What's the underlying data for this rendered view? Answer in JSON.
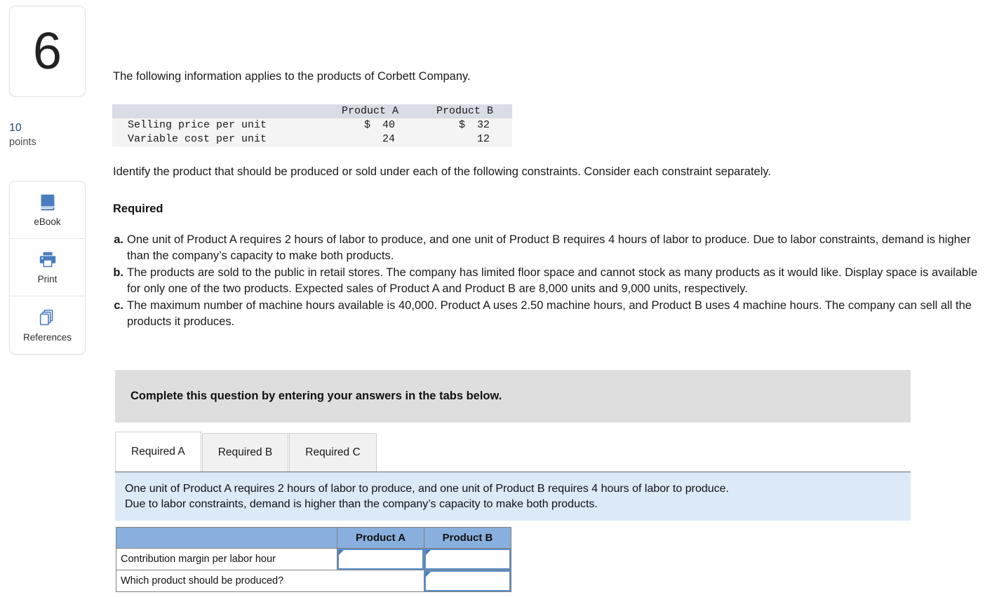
{
  "sidebar": {
    "question_number": "6",
    "points_value": "10",
    "points_label": "points",
    "tools": [
      {
        "name": "ebook",
        "label": "eBook",
        "icon": "book-icon"
      },
      {
        "name": "print",
        "label": "Print",
        "icon": "printer-icon"
      },
      {
        "name": "references",
        "label": "References",
        "icon": "copy-pages-icon"
      }
    ]
  },
  "main": {
    "intro": "The following information applies to the products of Corbett Company.",
    "identify": "Identify the product that should be produced or sold under each of the following constraints. Consider each constraint separately.",
    "required_heading": "Required",
    "requirements": [
      {
        "bullet": "a.",
        "text": "One unit of Product A requires 2 hours of labor to produce, and one unit of Product B requires 4 hours of labor to produce. Due to labor constraints, demand is higher than the company’s capacity to make both products."
      },
      {
        "bullet": "b.",
        "text": "The products are sold to the public in retail stores. The company has limited floor space and cannot stock as many products as it would like. Display space is available for only one of the two products. Expected sales of Product A and Product B are 8,000 units and 9,000 units, respectively."
      },
      {
        "bullet": "c.",
        "text": "The maximum number of machine hours available is 40,000. Product A uses 2.50 machine hours, and Product B uses 4 machine hours. The company can sell all the products it produces."
      }
    ],
    "banner_text": "Complete this question by entering your answers in the tabs below.",
    "tabs": [
      {
        "label": "Required A",
        "active": true
      },
      {
        "label": "Required B",
        "active": false
      },
      {
        "label": "Required C",
        "active": false
      }
    ],
    "instruction_box": {
      "line1": "One unit of Product A requires 2 hours of labor to produce, and one unit of Product B requires 4 hours of labor to produce.",
      "line2": "Due to labor constraints, demand is higher than the company’s capacity to make both products."
    }
  },
  "info_table": {
    "headers": [
      "",
      "Product A",
      "Product B"
    ],
    "rows": [
      {
        "label": "Selling price per unit",
        "a_currency": "$",
        "a_value": "40",
        "b_currency": "$",
        "b_value": "32"
      },
      {
        "label": "Variable cost per unit",
        "a_currency": "",
        "a_value": "24",
        "b_currency": "",
        "b_value": "12"
      }
    ]
  },
  "answer_table": {
    "headers": [
      "",
      "Product A",
      "Product B"
    ],
    "rows": [
      {
        "label": "Contribution margin per labor hour",
        "a_value": "",
        "b_value": "",
        "a_input": true,
        "b_input": true
      },
      {
        "label": "Which product should be produced?",
        "a_value": "",
        "b_value": "",
        "a_input": false,
        "b_input": true
      }
    ]
  },
  "colors": {
    "accent_blue": "#88afdd",
    "info_box_blue": "#dce9f7",
    "banner_gray": "#dededf",
    "points_blue": "#1f4e79",
    "input_border": "#5b8fc9"
  }
}
